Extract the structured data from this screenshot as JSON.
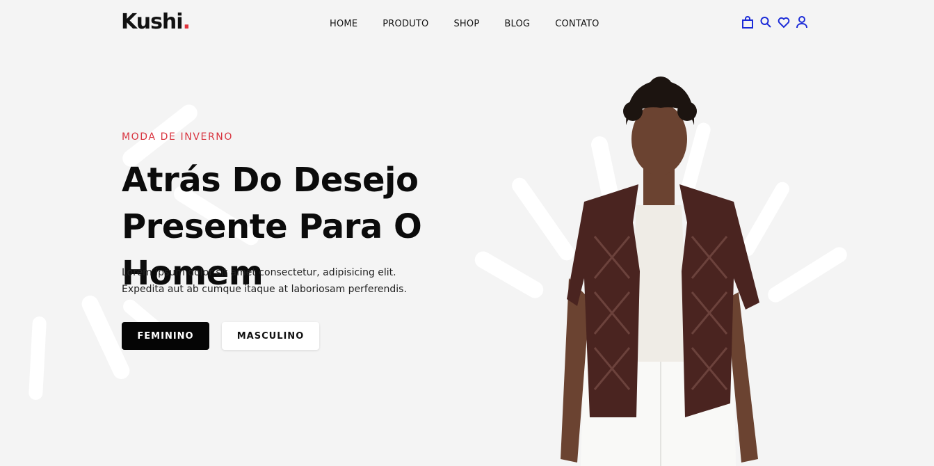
{
  "logo": {
    "text": "Kushi",
    "dot": "."
  },
  "nav": {
    "home": "HOME",
    "produto": "PRODUTO",
    "shop": "SHOP",
    "blog": "BLOG",
    "contato": "CONTATO"
  },
  "icons": [
    "bag-icon",
    "search-icon",
    "heart-icon",
    "user-icon"
  ],
  "hero": {
    "eyebrow": "MODA DE INVERNO",
    "headline_line1": "Atrás Do Desejo",
    "headline_line2": "Presente Para O Homem",
    "sub_line1": "Lorem ipsum dolor sit amet consectetur, adipisicing elit.",
    "sub_line2": "Expedita aut ab cumque itaque at laboriosam perferendis.",
    "btn_feminino": "FEMININO",
    "btn_masculino": "MASCULINO"
  },
  "colors": {
    "accent_red": "#e0313b",
    "icon_blue": "#1b2bd8",
    "background": "#f4f4f4",
    "shirt": "#4a2420"
  }
}
